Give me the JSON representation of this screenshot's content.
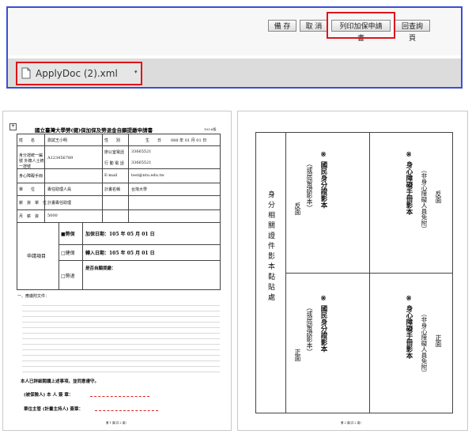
{
  "toolbar": {
    "buttons": [
      "備 存",
      "取 消",
      "列印加保申請書",
      "回查詢頁"
    ]
  },
  "download": {
    "file_name": "ApplyDoc (2).xml"
  },
  "doc_left": {
    "title": "國立臺灣大學勞(健)保加保及勞退金自願提繳申請書",
    "version": "103.6版",
    "rows": {
      "name_label": "姓　　名",
      "name_value": "測試王小明",
      "sex_label": "性　　別",
      "birth_label": "生　　日",
      "birth_value": "088 年 01 月 01 日",
      "id_label": "身分證統一編號 外籍人士統一證號",
      "id_value": "A123456789",
      "office_phone_label": "辦公室電話",
      "office_phone_value": "33665521",
      "mobile_label": "行 動 電 話",
      "mobile_value": "33665521",
      "id_type_label": "身心障礙手冊",
      "email_label": "E-mail",
      "email_value": "test@ntu.edu.tw",
      "unit_label": "單　　位",
      "unit_value": "專任助理人員",
      "plan_label": "計畫名稱",
      "plan_value": "台灣大學",
      "pay_label": "薪　資　單　位",
      "pay_value": "計畫專任助理",
      "salary_label": "月　薪　資",
      "salary_value": "5000",
      "apply_label": "申請項目",
      "labor": "■勞保",
      "labor_date": "加保日期：105 年 05 月 01 日",
      "health": "□健保",
      "health_date": "轉入日期：105 年 05 月 01 日",
      "pension": "□勞退",
      "pension_label": "是否自願提繳："
    },
    "notes_heading": "一、應繳附文件：",
    "sign_line1": "本人已詳細閱讀上述事項，並同意遵守。",
    "sign_applicant": "(被保險人) 本 人 簽 章：",
    "sign_unit": "單位主管 (計畫主持人) 簽章：",
    "footer": "第 1 頁(共 2 頁)"
  },
  "doc_right": {
    "left_col_label": "身分相關證件影本黏貼處",
    "cell_tl_title": "※ 國民身分證影本",
    "cell_tl_sub": "（或居留證影本）",
    "cell_tl_side": "反面",
    "cell_tr_title": "※ 身心障礙手冊影本",
    "cell_tr_sub": "（非身心障礙人員免附）",
    "cell_tr_side": "反面",
    "cell_bl_title": "※ 國民身分證影本",
    "cell_bl_sub": "（或居留證影本）",
    "cell_bl_side": "正面",
    "cell_br_title": "※ 身心障礙手冊影本",
    "cell_br_sub": "（非身心障礙人員免附）",
    "cell_br_side": "正面",
    "footer": "第 2 頁(共 2 頁)"
  }
}
